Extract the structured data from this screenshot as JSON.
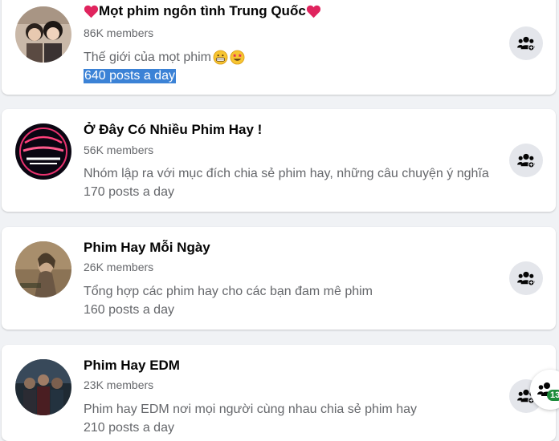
{
  "groups": [
    {
      "name": "Mọt phim ngôn tình Trung Quốc",
      "members": "86K members",
      "description": "Thế giới của mọt phim",
      "posts": "640 posts a day",
      "avatar_icon": "two-people-photo",
      "selected_posts": true
    },
    {
      "name": "Ở Đây Có Nhiều Phim Hay !",
      "members": "56K members",
      "description": "Nhóm lập ra với mục đích chia sẻ phim hay, những câu chuyện ý nghĩa",
      "posts": "170 posts a day",
      "avatar_icon": "neon-logo"
    },
    {
      "name": "Phim Hay Mỗi Ngày",
      "members": "26K members",
      "description": "Tổng hợp các phim hay cho các bạn đam mê phim",
      "posts": "160 posts a day",
      "avatar_icon": "movie-poster"
    },
    {
      "name": "Phim Hay EDM",
      "members": "23K members",
      "description": "Phim hay EDM nơi mọi người cùng nhau chia sẻ phim hay",
      "posts": "210 posts a day",
      "avatar_icon": "superhero-group"
    }
  ],
  "floating_badge": "13",
  "colors": {
    "background": "#f0f2f5",
    "card": "#ffffff",
    "secondary_text": "#65676b",
    "selection": "#3b82d6",
    "button_bg": "#e4e6eb",
    "heart": "#e0245e"
  },
  "icons": {
    "join": "group-join-icon",
    "heart": "red-heart-icon",
    "grin": "grinning-face-icon",
    "star_eyes": "star-struck-face-icon"
  }
}
